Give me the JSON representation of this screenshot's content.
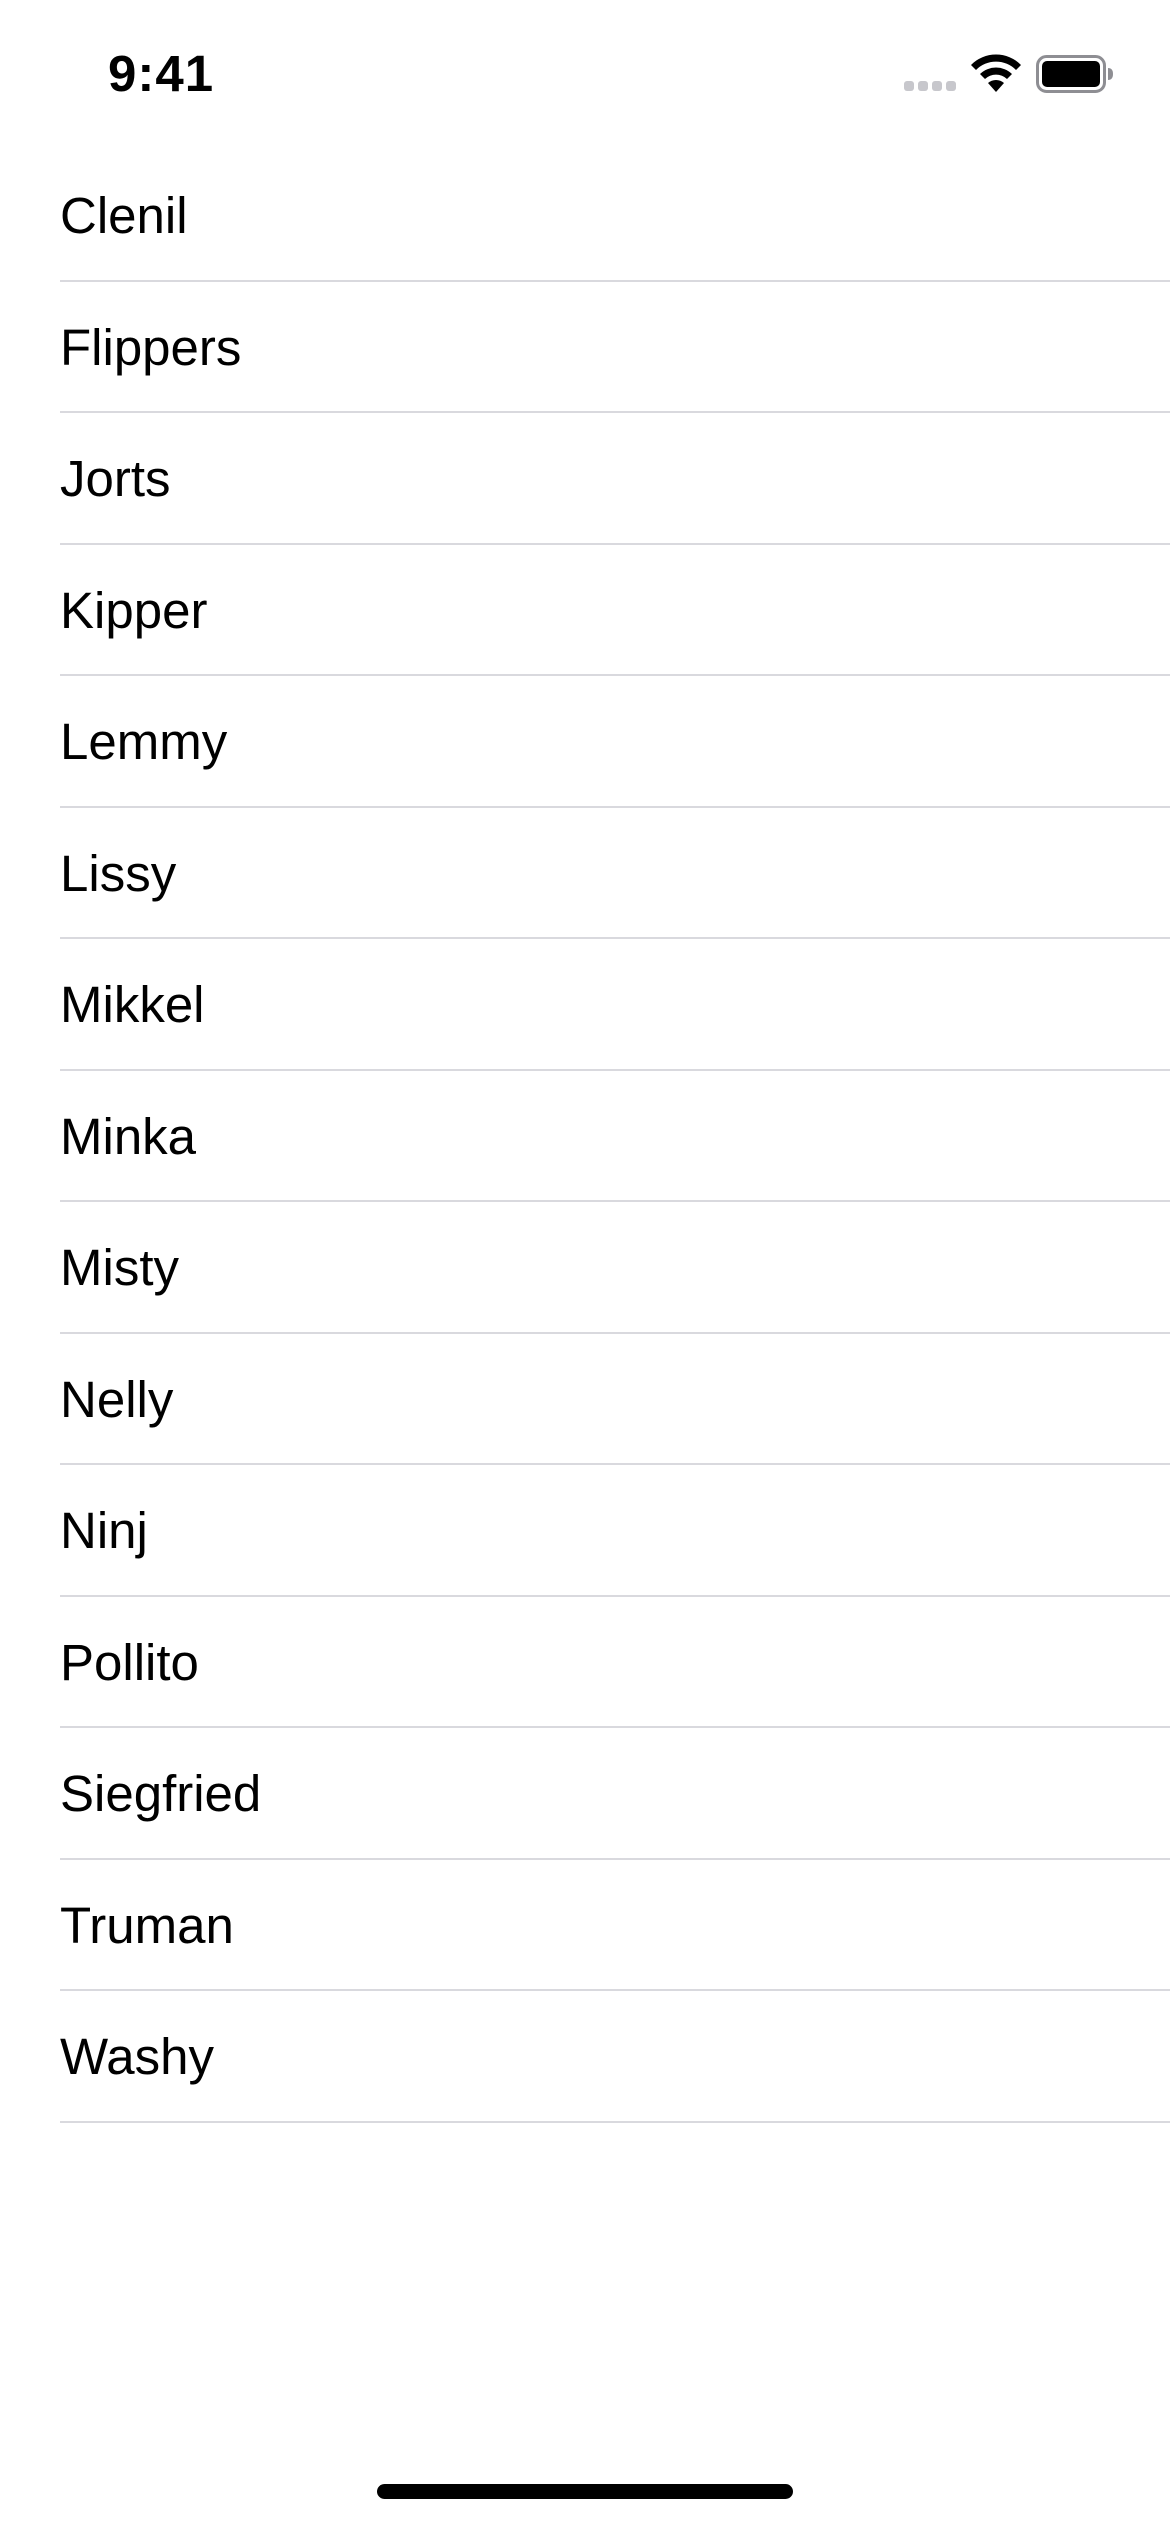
{
  "status_bar": {
    "time": "9:41",
    "signal_icon": "cellular-signal-icon",
    "wifi_icon": "wifi-icon",
    "battery_icon": "battery-icon"
  },
  "list": {
    "items": [
      {
        "label": "Clenil"
      },
      {
        "label": "Flippers"
      },
      {
        "label": "Jorts"
      },
      {
        "label": "Kipper"
      },
      {
        "label": "Lemmy"
      },
      {
        "label": "Lissy"
      },
      {
        "label": "Mikkel"
      },
      {
        "label": "Minka"
      },
      {
        "label": "Misty"
      },
      {
        "label": "Nelly"
      },
      {
        "label": "Ninj"
      },
      {
        "label": "Pollito"
      },
      {
        "label": "Siegfried"
      },
      {
        "label": "Truman"
      },
      {
        "label": "Washy"
      }
    ]
  },
  "colors": {
    "background": "#ffffff",
    "text": "#000000",
    "separator": "#d9d9de",
    "inactive_signal": "#c7c7cc"
  }
}
